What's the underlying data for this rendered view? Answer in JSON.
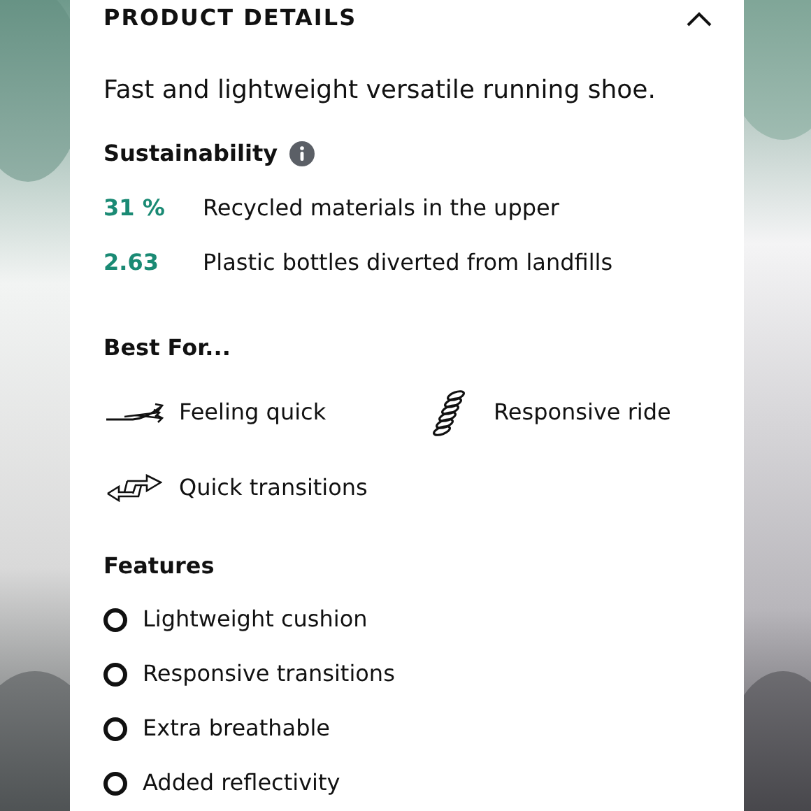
{
  "section": {
    "title": "PRODUCT DETAILS",
    "expanded": true
  },
  "description": "Fast and lightweight versatile running shoe.",
  "sustainability": {
    "heading": "Sustainability",
    "stats": [
      {
        "value": "31 %",
        "label": "Recycled materials in the upper"
      },
      {
        "value": "2.63",
        "label": "Plastic bottles diverted from landfills"
      }
    ]
  },
  "best_for": {
    "heading": "Best For...",
    "items": [
      {
        "kind": "speed",
        "label": "Feeling quick"
      },
      {
        "kind": "spring",
        "label": "Responsive ride"
      },
      {
        "kind": "arrows",
        "label": "Quick transitions"
      }
    ]
  },
  "features": {
    "heading": "Features",
    "items": [
      "Lightweight cushion",
      "Responsive transitions",
      "Extra breathable",
      "Added reflectivity"
    ]
  }
}
